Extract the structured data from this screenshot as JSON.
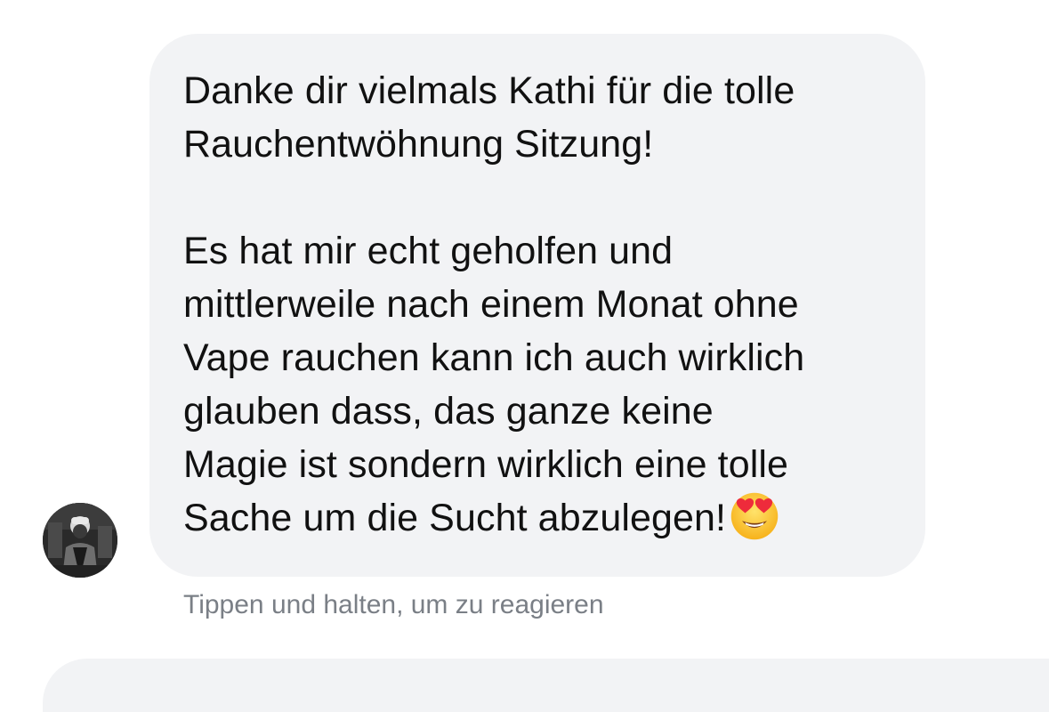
{
  "conversation": {
    "message": {
      "text": "Danke dir vielmals Kathi für die tolle\nRauchentwöhnung Sitzung!\n\nEs hat mir echt geholfen und\nmittlerweile nach einem Monat ohne\nVape rauchen kann ich auch wirklich\nglauben dass, das ganze keine\nMagie ist sondern wirklich eine tolle\nSache um die Sucht abzulegen!",
      "emoji": "heart-eyes-emoji",
      "bubble_color": "#f2f3f5",
      "text_color": "#111111"
    },
    "reaction_hint": "Tippen und halten, um zu reagieren",
    "sender_avatar": "sender-photo-avatar"
  }
}
